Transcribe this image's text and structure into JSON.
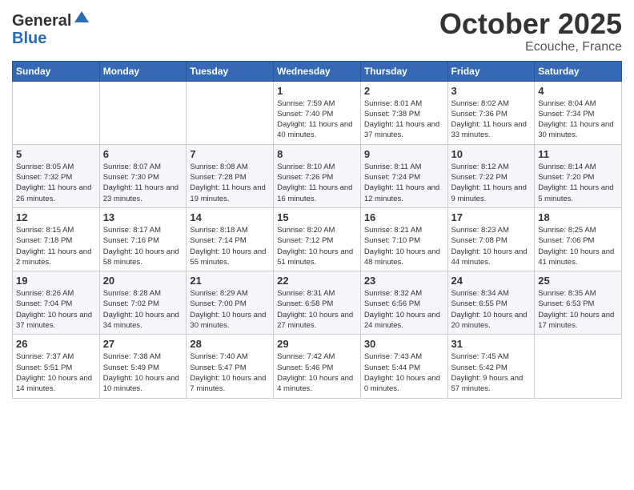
{
  "header": {
    "logo_line1": "General",
    "logo_line2": "Blue",
    "month": "October 2025",
    "location": "Ecouche, France"
  },
  "weekdays": [
    "Sunday",
    "Monday",
    "Tuesday",
    "Wednesday",
    "Thursday",
    "Friday",
    "Saturday"
  ],
  "weeks": [
    [
      {
        "day": "",
        "sunrise": "",
        "sunset": "",
        "daylight": ""
      },
      {
        "day": "",
        "sunrise": "",
        "sunset": "",
        "daylight": ""
      },
      {
        "day": "",
        "sunrise": "",
        "sunset": "",
        "daylight": ""
      },
      {
        "day": "1",
        "sunrise": "Sunrise: 7:59 AM",
        "sunset": "Sunset: 7:40 PM",
        "daylight": "Daylight: 11 hours and 40 minutes."
      },
      {
        "day": "2",
        "sunrise": "Sunrise: 8:01 AM",
        "sunset": "Sunset: 7:38 PM",
        "daylight": "Daylight: 11 hours and 37 minutes."
      },
      {
        "day": "3",
        "sunrise": "Sunrise: 8:02 AM",
        "sunset": "Sunset: 7:36 PM",
        "daylight": "Daylight: 11 hours and 33 minutes."
      },
      {
        "day": "4",
        "sunrise": "Sunrise: 8:04 AM",
        "sunset": "Sunset: 7:34 PM",
        "daylight": "Daylight: 11 hours and 30 minutes."
      }
    ],
    [
      {
        "day": "5",
        "sunrise": "Sunrise: 8:05 AM",
        "sunset": "Sunset: 7:32 PM",
        "daylight": "Daylight: 11 hours and 26 minutes."
      },
      {
        "day": "6",
        "sunrise": "Sunrise: 8:07 AM",
        "sunset": "Sunset: 7:30 PM",
        "daylight": "Daylight: 11 hours and 23 minutes."
      },
      {
        "day": "7",
        "sunrise": "Sunrise: 8:08 AM",
        "sunset": "Sunset: 7:28 PM",
        "daylight": "Daylight: 11 hours and 19 minutes."
      },
      {
        "day": "8",
        "sunrise": "Sunrise: 8:10 AM",
        "sunset": "Sunset: 7:26 PM",
        "daylight": "Daylight: 11 hours and 16 minutes."
      },
      {
        "day": "9",
        "sunrise": "Sunrise: 8:11 AM",
        "sunset": "Sunset: 7:24 PM",
        "daylight": "Daylight: 11 hours and 12 minutes."
      },
      {
        "day": "10",
        "sunrise": "Sunrise: 8:12 AM",
        "sunset": "Sunset: 7:22 PM",
        "daylight": "Daylight: 11 hours and 9 minutes."
      },
      {
        "day": "11",
        "sunrise": "Sunrise: 8:14 AM",
        "sunset": "Sunset: 7:20 PM",
        "daylight": "Daylight: 11 hours and 5 minutes."
      }
    ],
    [
      {
        "day": "12",
        "sunrise": "Sunrise: 8:15 AM",
        "sunset": "Sunset: 7:18 PM",
        "daylight": "Daylight: 11 hours and 2 minutes."
      },
      {
        "day": "13",
        "sunrise": "Sunrise: 8:17 AM",
        "sunset": "Sunset: 7:16 PM",
        "daylight": "Daylight: 10 hours and 58 minutes."
      },
      {
        "day": "14",
        "sunrise": "Sunrise: 8:18 AM",
        "sunset": "Sunset: 7:14 PM",
        "daylight": "Daylight: 10 hours and 55 minutes."
      },
      {
        "day": "15",
        "sunrise": "Sunrise: 8:20 AM",
        "sunset": "Sunset: 7:12 PM",
        "daylight": "Daylight: 10 hours and 51 minutes."
      },
      {
        "day": "16",
        "sunrise": "Sunrise: 8:21 AM",
        "sunset": "Sunset: 7:10 PM",
        "daylight": "Daylight: 10 hours and 48 minutes."
      },
      {
        "day": "17",
        "sunrise": "Sunrise: 8:23 AM",
        "sunset": "Sunset: 7:08 PM",
        "daylight": "Daylight: 10 hours and 44 minutes."
      },
      {
        "day": "18",
        "sunrise": "Sunrise: 8:25 AM",
        "sunset": "Sunset: 7:06 PM",
        "daylight": "Daylight: 10 hours and 41 minutes."
      }
    ],
    [
      {
        "day": "19",
        "sunrise": "Sunrise: 8:26 AM",
        "sunset": "Sunset: 7:04 PM",
        "daylight": "Daylight: 10 hours and 37 minutes."
      },
      {
        "day": "20",
        "sunrise": "Sunrise: 8:28 AM",
        "sunset": "Sunset: 7:02 PM",
        "daylight": "Daylight: 10 hours and 34 minutes."
      },
      {
        "day": "21",
        "sunrise": "Sunrise: 8:29 AM",
        "sunset": "Sunset: 7:00 PM",
        "daylight": "Daylight: 10 hours and 30 minutes."
      },
      {
        "day": "22",
        "sunrise": "Sunrise: 8:31 AM",
        "sunset": "Sunset: 6:58 PM",
        "daylight": "Daylight: 10 hours and 27 minutes."
      },
      {
        "day": "23",
        "sunrise": "Sunrise: 8:32 AM",
        "sunset": "Sunset: 6:56 PM",
        "daylight": "Daylight: 10 hours and 24 minutes."
      },
      {
        "day": "24",
        "sunrise": "Sunrise: 8:34 AM",
        "sunset": "Sunset: 6:55 PM",
        "daylight": "Daylight: 10 hours and 20 minutes."
      },
      {
        "day": "25",
        "sunrise": "Sunrise: 8:35 AM",
        "sunset": "Sunset: 6:53 PM",
        "daylight": "Daylight: 10 hours and 17 minutes."
      }
    ],
    [
      {
        "day": "26",
        "sunrise": "Sunrise: 7:37 AM",
        "sunset": "Sunset: 5:51 PM",
        "daylight": "Daylight: 10 hours and 14 minutes."
      },
      {
        "day": "27",
        "sunrise": "Sunrise: 7:38 AM",
        "sunset": "Sunset: 5:49 PM",
        "daylight": "Daylight: 10 hours and 10 minutes."
      },
      {
        "day": "28",
        "sunrise": "Sunrise: 7:40 AM",
        "sunset": "Sunset: 5:47 PM",
        "daylight": "Daylight: 10 hours and 7 minutes."
      },
      {
        "day": "29",
        "sunrise": "Sunrise: 7:42 AM",
        "sunset": "Sunset: 5:46 PM",
        "daylight": "Daylight: 10 hours and 4 minutes."
      },
      {
        "day": "30",
        "sunrise": "Sunrise: 7:43 AM",
        "sunset": "Sunset: 5:44 PM",
        "daylight": "Daylight: 10 hours and 0 minutes."
      },
      {
        "day": "31",
        "sunrise": "Sunrise: 7:45 AM",
        "sunset": "Sunset: 5:42 PM",
        "daylight": "Daylight: 9 hours and 57 minutes."
      },
      {
        "day": "",
        "sunrise": "",
        "sunset": "",
        "daylight": ""
      }
    ]
  ]
}
